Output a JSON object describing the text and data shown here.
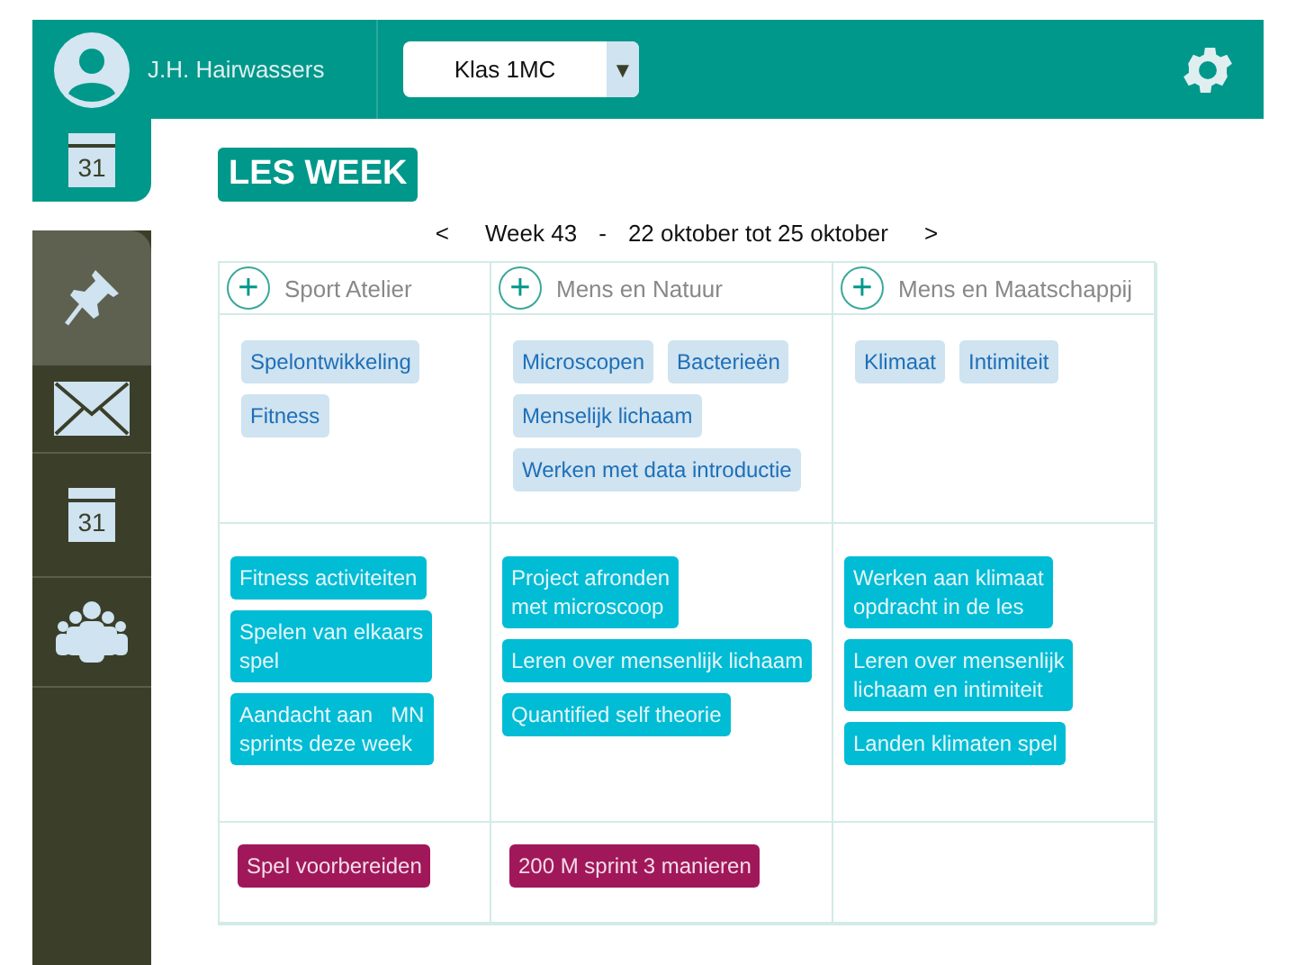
{
  "header": {
    "user_name": "J.H. Hairwassers",
    "class_select": {
      "value": "Klas 1MC",
      "arrow": "▼"
    }
  },
  "top_tab": {
    "kind": "calendar",
    "label": "31",
    "selected": true
  },
  "sidebar": {
    "items": [
      {
        "kind": "pin",
        "selected": true
      },
      {
        "kind": "mail",
        "selected": false
      },
      {
        "kind": "calendar",
        "label": "31",
        "selected": false
      },
      {
        "kind": "people",
        "selected": false
      }
    ]
  },
  "page_title": "LES WEEK",
  "week_nav": {
    "prev": "<",
    "week": "Week 43",
    "separator": "-",
    "range": "22 oktober tot 25 oktober",
    "next": ">"
  },
  "columns": [
    {
      "add": "+",
      "title": "Sport Atelier"
    },
    {
      "add": "+",
      "title": "Mens en Natuur"
    },
    {
      "add": "+",
      "title": "Mens en Maatschappij"
    }
  ],
  "rows": [
    {
      "kind": "topic",
      "cells": [
        [
          "Spelontwikkeling",
          "Fitness"
        ],
        [
          "Microscopen",
          "Bacterieën",
          "Menselijk lichaam",
          "Werken met data introductie"
        ],
        [
          "Klimaat",
          "Intimiteit"
        ]
      ]
    },
    {
      "kind": "activity",
      "cells": [
        [
          "Fitness activiteiten",
          "Spelen van elkaars\nspel",
          "Aandacht aan   MN\nsprints deze week"
        ],
        [
          "Project afronden\nmet microscoop",
          "Leren over mensenlijk lichaam",
          "Quantified self theorie"
        ],
        [
          "Werken aan klimaat\nopdracht in de les",
          "Leren over mensenlijk\nlichaam en intimiteit",
          "Landen klimaten spel"
        ]
      ]
    },
    {
      "kind": "task",
      "cells": [
        [
          "Spel voorbereiden"
        ],
        [
          "200 M sprint 3 manieren"
        ],
        []
      ]
    }
  ]
}
